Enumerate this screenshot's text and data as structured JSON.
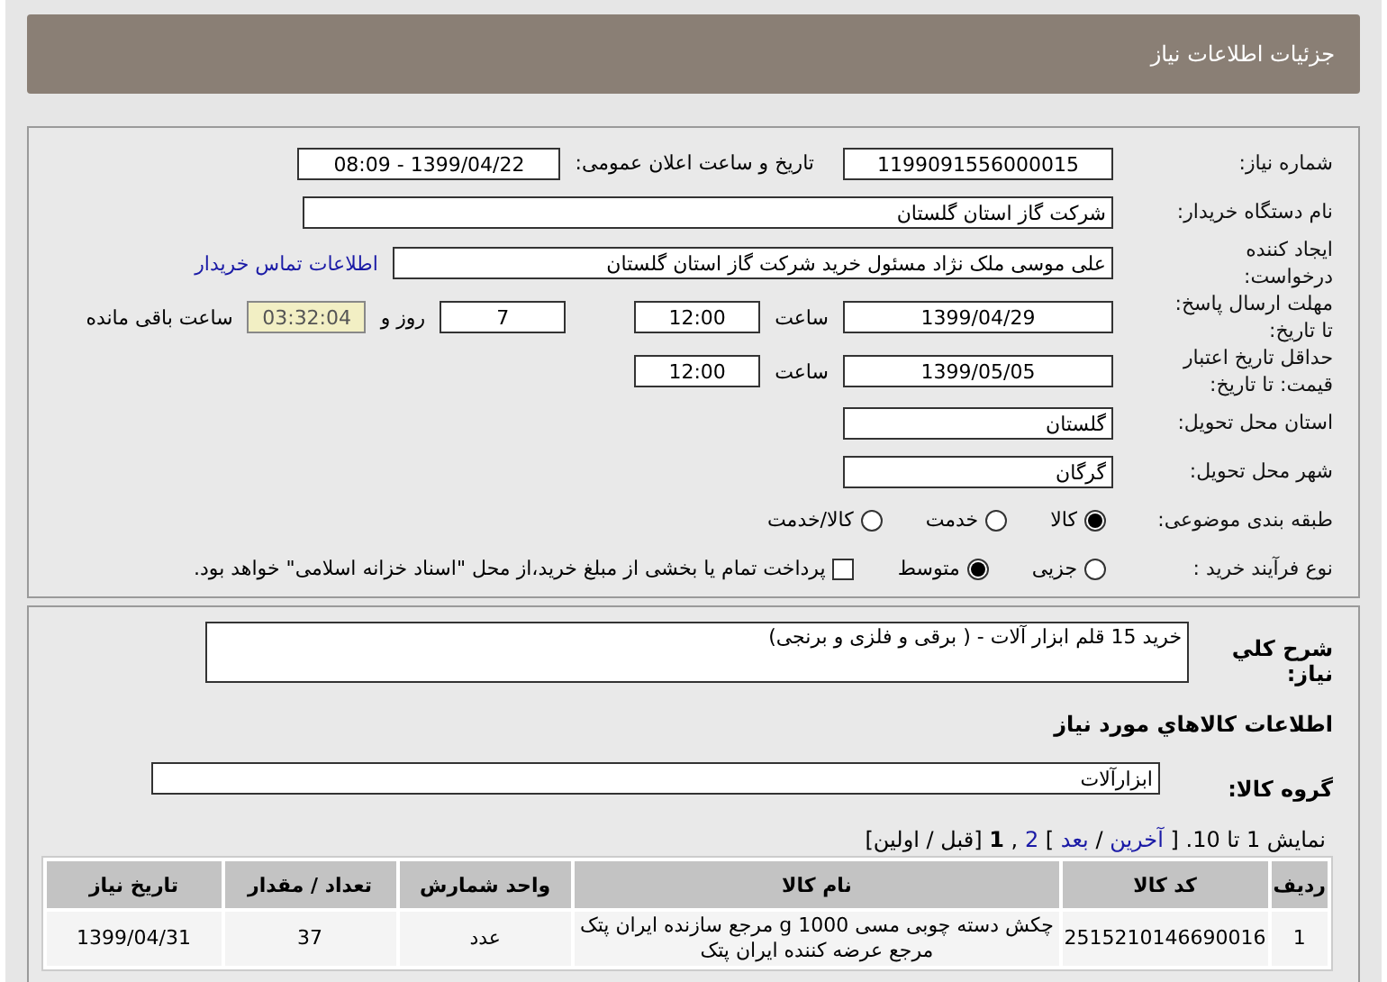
{
  "header": {
    "title": "جزئیات اطلاعات نیاز"
  },
  "details": {
    "need_number": {
      "label": "شماره نیاز:",
      "value": "1199091556000015"
    },
    "announce": {
      "label": "تاریخ و ساعت اعلان عمومی:",
      "value": "1399/04/22 - 08:09"
    },
    "buyer": {
      "label": "نام دستگاه خریدار:",
      "value": "شرکت گاز استان گلستان"
    },
    "creator": {
      "label": "ایجاد کننده\nدرخواست:",
      "value": "علی موسی ملک نژاد مسئول خرید شرکت گاز استان گلستان",
      "link": "اطلاعات تماس خریدار"
    },
    "deadline": {
      "label": "مهلت ارسال پاسخ:\nتا تاریخ:",
      "date": "1399/04/29",
      "time_label": "ساعت",
      "time": "12:00",
      "days": "7",
      "days_label": "روز و",
      "remaining": "03:32:04",
      "remaining_label": "ساعت باقی مانده"
    },
    "validity": {
      "label": "حداقل تاریخ اعتبار\nقیمت: تا تاریخ:",
      "date": "1399/05/05",
      "time_label": "ساعت",
      "time": "12:00"
    },
    "province": {
      "label": "استان محل تحویل:",
      "value": "گلستان"
    },
    "city": {
      "label": "شهر محل تحویل:",
      "value": "گرگان"
    },
    "category": {
      "label": "طبقه بندی موضوعی:",
      "options": [
        {
          "label": "کالا",
          "selected": true
        },
        {
          "label": "خدمت",
          "selected": false
        },
        {
          "label": "کالا/خدمت",
          "selected": false
        }
      ]
    },
    "process": {
      "label": "نوع فرآیند خرید :",
      "options": [
        {
          "label": "جزیی",
          "selected": false
        },
        {
          "label": "متوسط",
          "selected": true
        }
      ],
      "treasury": {
        "label": "پرداخت تمام یا بخشی از مبلغ خرید،از محل \"اسناد خزانه اسلامی\" خواهد بود.",
        "checked": false
      }
    }
  },
  "summary": {
    "label": "شرح کلي نياز:",
    "value": "خرید 15 قلم ابزار آلات - ( برقی و فلزی و برنجی)"
  },
  "goods_heading": "اطلاعات كالاهاي مورد نياز",
  "goods_group": {
    "label": "گروه کالا:",
    "value": "ابزارآلات"
  },
  "pagination": [
    {
      "kind": "text",
      "text": "نمایش 1 تا 10. ["
    },
    {
      "kind": "link",
      "text": "آخرین"
    },
    {
      "kind": "text",
      "text": "/"
    },
    {
      "kind": "link",
      "text": "بعد"
    },
    {
      "kind": "text",
      "text": "]"
    },
    {
      "kind": "link",
      "text": "2"
    },
    {
      "kind": "text",
      "text": ","
    },
    {
      "kind": "current",
      "text": "1"
    },
    {
      "kind": "text",
      "text": "[قبل / اولین]"
    }
  ],
  "table": {
    "columns": [
      "ردیف",
      "کد کالا",
      "نام کالا",
      "واحد شمارش",
      "تعداد / مقدار",
      "تاریخ نیاز"
    ],
    "rows": [
      [
        "1",
        "2515210146690016",
        "چکش دسته چوبی مسی 1000 g مرجع سازنده ایران پتک مرجع عرضه کننده ایران پتک",
        "عدد",
        "37",
        "1399/04/31"
      ]
    ]
  }
}
